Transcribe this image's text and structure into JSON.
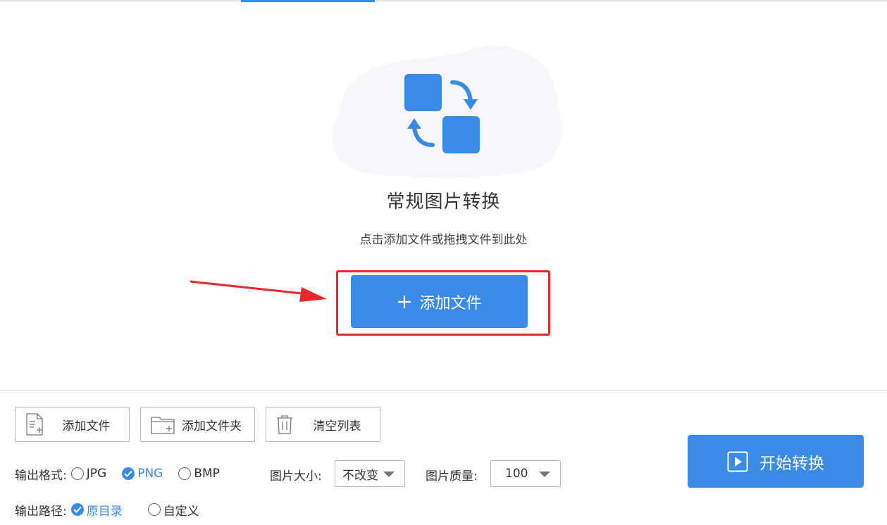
{
  "drop_area": {
    "title": "常规图片转换",
    "hint": "点击添加文件或拖拽文件到此处",
    "add_button_label": "添加文件"
  },
  "toolbar": {
    "add_file_label": "添加文件",
    "add_folder_label": "添加文件夹",
    "clear_list_label": "清空列表"
  },
  "output_format": {
    "label": "输出格式:",
    "options": [
      {
        "label": "JPG",
        "selected": false
      },
      {
        "label": "PNG",
        "selected": true
      },
      {
        "label": "BMP",
        "selected": false
      }
    ]
  },
  "image_size": {
    "label": "图片大小:",
    "value": "不改变"
  },
  "image_quality": {
    "label": "图片质量:",
    "value": "100"
  },
  "output_path": {
    "label": "输出路径:",
    "options": [
      {
        "label": "原目录",
        "selected": true
      },
      {
        "label": "自定义",
        "selected": false
      }
    ]
  },
  "start_button_label": "开始转换",
  "colors": {
    "accent": "#3a8ae8",
    "highlight": "#e8282d"
  }
}
